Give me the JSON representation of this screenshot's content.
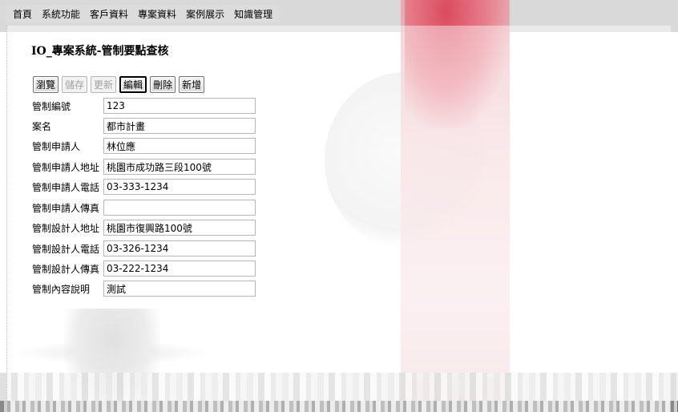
{
  "menu": {
    "items": [
      "首頁",
      "系統功能",
      "客戶資料",
      "專案資料",
      "案例展示",
      "知識管理"
    ]
  },
  "page": {
    "title": "IO_專案系統-管制要點查核"
  },
  "toolbar": {
    "browse_label": "瀏覽",
    "save_label": "儲存",
    "update_label": "更新",
    "edit_label": "編輯",
    "delete_label": "刪除",
    "add_label": "新增"
  },
  "form": {
    "fields": [
      {
        "label": "管制編號",
        "value": "123"
      },
      {
        "label": "案名",
        "value": "都市計畫"
      },
      {
        "label": "管制申請人",
        "value": "林位應"
      },
      {
        "label": "管制申請人地址",
        "value": "桃園市成功路三段100號"
      },
      {
        "label": "管制申請人電話",
        "value": "03-333-1234"
      },
      {
        "label": "管制申請人傳真",
        "value": ""
      },
      {
        "label": "管制設計人地址",
        "value": "桃園市復興路100號"
      },
      {
        "label": "管制設計人電話",
        "value": "03-326-1234"
      },
      {
        "label": "管制設計人傳真",
        "value": "03-222-1234"
      },
      {
        "label": "管制內容說明",
        "value": "測試"
      }
    ]
  }
}
